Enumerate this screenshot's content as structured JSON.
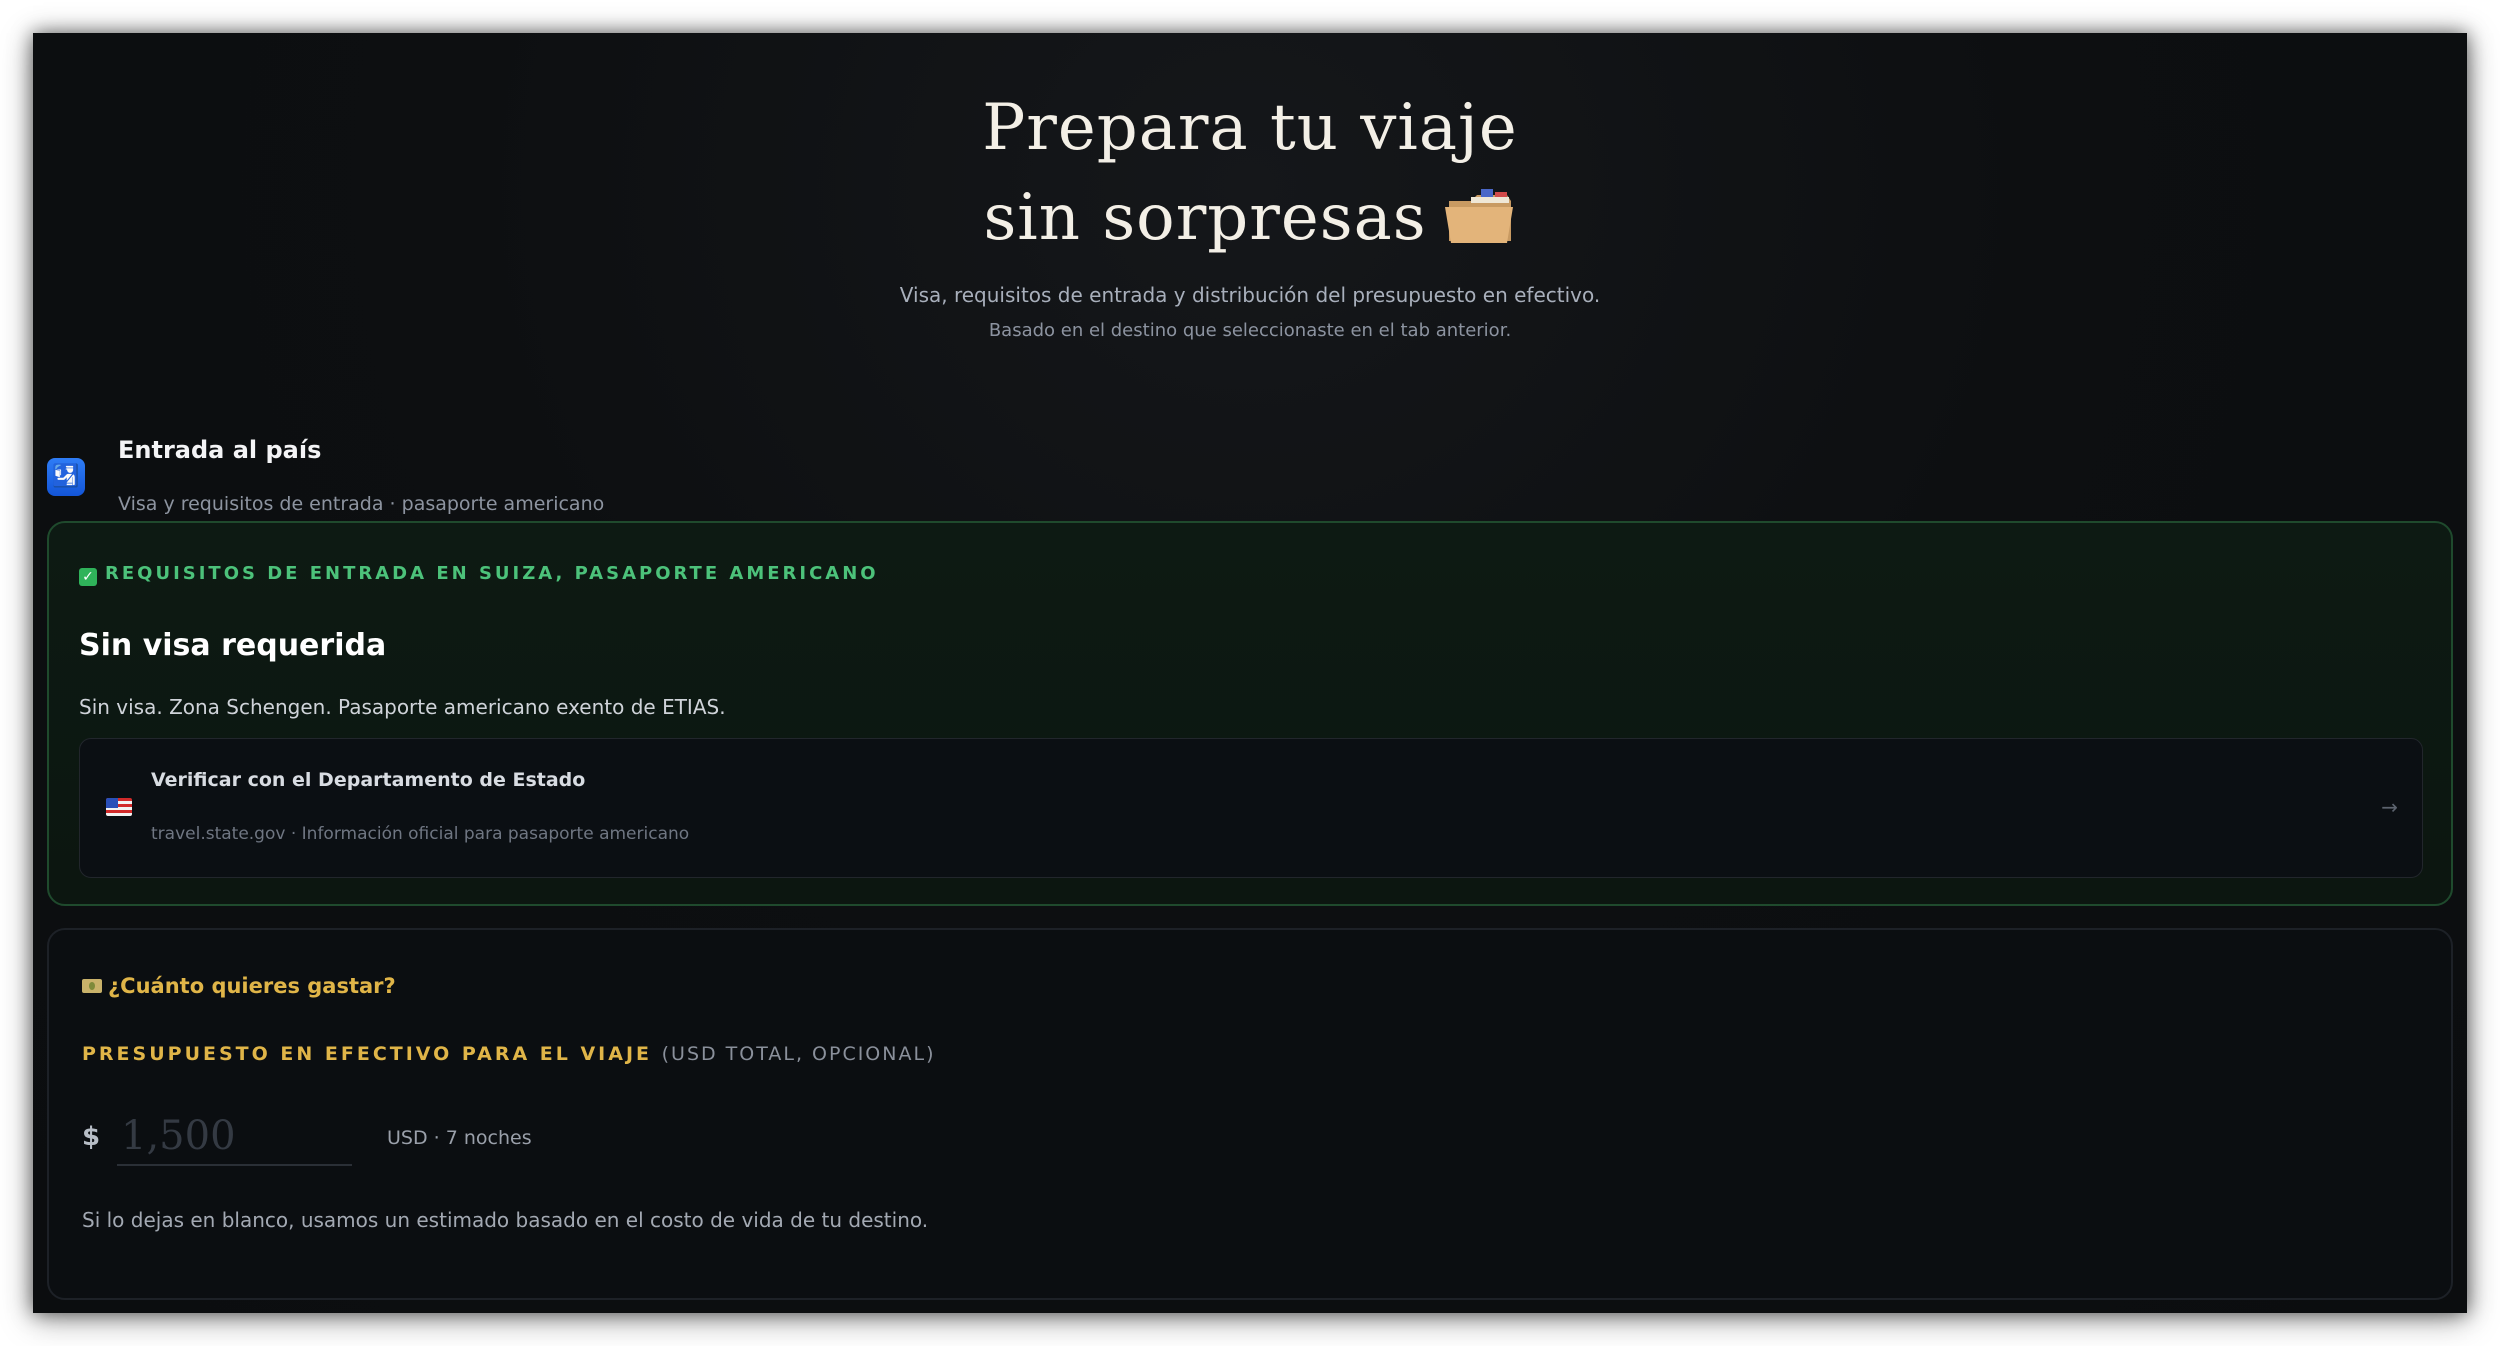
{
  "hero": {
    "title_line1": "Prepara tu viaje",
    "title_line2": "sin sorpresas",
    "title_icon": "folder-icon",
    "subtitle": "Visa, requisitos de entrada y distribución del presupuesto en efectivo.",
    "subtitle2": "Basado en el destino que seleccionaste en el tab anterior."
  },
  "entry_section": {
    "icon": "passport-control-icon",
    "title": "Entrada al país",
    "subtitle": "Visa y requisitos de entrada · pasaporte americano"
  },
  "entry_card": {
    "kicker_icon": "check-icon",
    "kicker": "REQUISITOS DE ENTRADA EN SUIZA, PASAPORTE AMERICANO",
    "title": "Sin visa requerida",
    "description": "Sin visa. Zona Schengen. Pasaporte americano exento de ETIAS.",
    "verify": {
      "icon": "us-flag-icon",
      "title": "Verificar con el Departamento de Estado",
      "subtitle": "travel.state.gov · Información oficial para pasaporte americano",
      "arrow": "→"
    },
    "accent_color": "#4cc27a"
  },
  "budget_card": {
    "question_icon": "money-icon",
    "question": "¿Cuánto quieres gastar?",
    "label": "PRESUPUESTO EN EFECTIVO PARA EL VIAJE",
    "label_note": "(USD TOTAL, OPCIONAL)",
    "currency": "$",
    "input_placeholder": "1,500",
    "input_value": "",
    "unit": "USD · 7 noches",
    "hint": "Si lo dejas en blanco, usamos un estimado basado en el costo de vida de tu destino.",
    "accent_color": "#e0b548"
  }
}
